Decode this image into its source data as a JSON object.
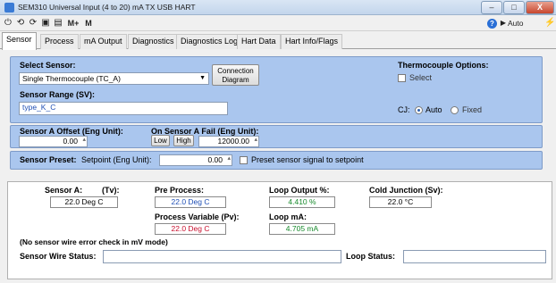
{
  "window": {
    "title": "SEM310 Universal Input (4 to 20) mA TX USB HART",
    "minimize": "–",
    "maximize": "□",
    "close": "X"
  },
  "toolbar": {
    "power_icon": "⏻",
    "back_icon": "⟲",
    "forward_icon": "⟳",
    "save_icon": "▣",
    "print_icon": "▤",
    "mplus_label": "M+",
    "m_label": "M",
    "help_icon": "?",
    "auto_read_label": "Auto Read",
    "connect_icon": "⚡"
  },
  "tabs": [
    {
      "label": "Sensor"
    },
    {
      "label": "Process"
    },
    {
      "label": "mA Output"
    },
    {
      "label": "Diagnostics"
    },
    {
      "label": "Diagnostics Log"
    },
    {
      "label": "Hart Data"
    },
    {
      "label": "Hart Info/Flags"
    }
  ],
  "sensor_panel": {
    "select_sensor_label": "Select Sensor:",
    "select_sensor_value": "Single Thermocouple (TC_A)",
    "connection_diagram_label": "Connection\nDiagram",
    "thermocouple_options_label": "Thermocouple Options:",
    "select_checkbox_label": "Select",
    "sensor_range_label": "Sensor Range (SV):",
    "sensor_range_value": "type_K_C",
    "cj_label": "CJ:",
    "cj_auto_label": "Auto",
    "cj_fixed_label": "Fixed"
  },
  "offset_panel": {
    "offset_label": "Sensor A Offset (Eng Unit):",
    "offset_value": "0.00",
    "fail_label": "On Sensor A Fail (Eng Unit):",
    "low_label": "Low",
    "high_label": "High",
    "fail_value": "12000.00"
  },
  "preset_panel": {
    "preset_label": "Sensor Preset:",
    "setpoint_label": "Setpoint (Eng Unit):",
    "setpoint_value": "0.00",
    "preset_checkbox_label": "Preset sensor signal to setpoint"
  },
  "readings": {
    "sensor_a_label": "Sensor A:",
    "tv_label": "(Tv):",
    "sensor_a_value": "22.0 Deg C",
    "pre_process_label": "Pre Process:",
    "pre_process_value": "22.0 Deg C",
    "loop_output_label": "Loop Output %:",
    "loop_output_value": "4.410 %",
    "cold_junction_label": "Cold Junction (Sv):",
    "cold_junction_value": "22.0 °C",
    "pv_label": "Process Variable (Pv):",
    "pv_value": "22.0 Deg C",
    "loop_ma_label": "Loop mA:",
    "loop_ma_value": "4.705 mA",
    "note": "(No sensor wire error check in mV mode)",
    "wire_status_label": "Sensor Wire Status:",
    "wire_status_value": "",
    "loop_status_label": "Loop Status:",
    "loop_status_value": ""
  },
  "colors": {
    "panel": "#aac6ee",
    "pv_text": "#c8102e",
    "pre_process_text": "#1f4fb5",
    "loop_text": "#178a2c"
  }
}
